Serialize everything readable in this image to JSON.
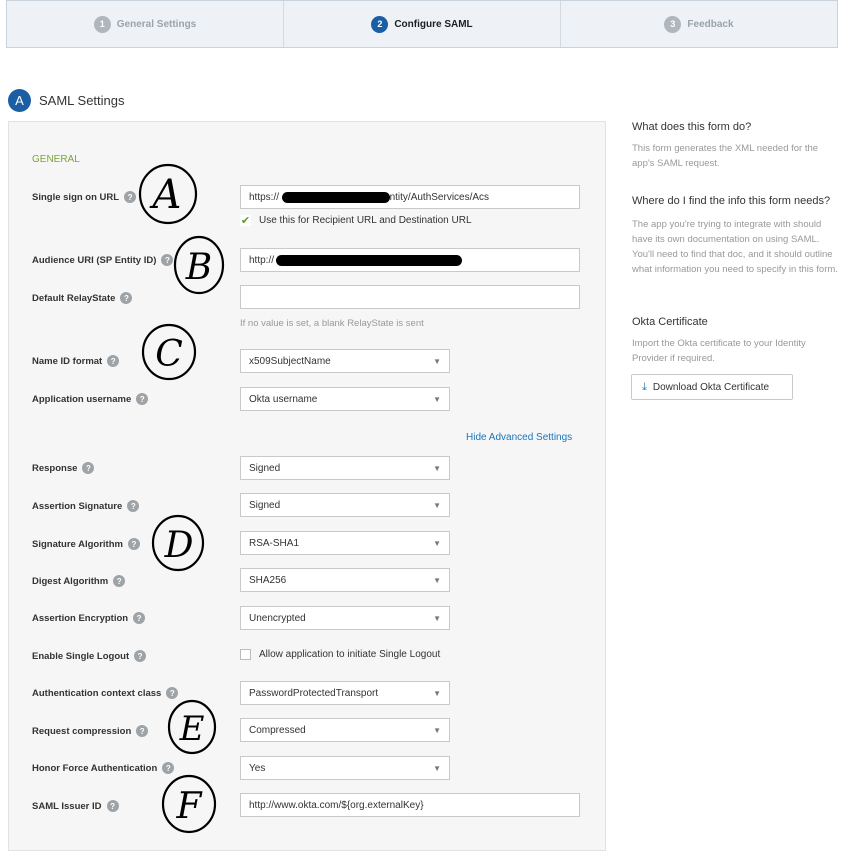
{
  "wizard": {
    "steps": [
      {
        "num": "1",
        "label": "General Settings"
      },
      {
        "num": "2",
        "label": "Configure SAML"
      },
      {
        "num": "3",
        "label": "Feedback"
      }
    ]
  },
  "section": {
    "badge": "A",
    "title": "SAML Settings"
  },
  "form": {
    "general_heading": "GENERAL",
    "sso_url_label": "Single sign on URL",
    "sso_url_prefix": "https://",
    "sso_url_suffix": "entity/AuthServices/Acs",
    "use_recipient_label": "Use this for Recipient URL and Destination URL",
    "audience_label": "Audience URI (SP Entity ID)",
    "audience_prefix": "http://",
    "relay_label": "Default RelayState",
    "relay_value": "",
    "relay_hint": "If no value is set, a blank RelayState is sent",
    "nameid_label": "Name ID format",
    "nameid_value": "x509SubjectName",
    "appuser_label": "Application username",
    "appuser_value": "Okta username",
    "hide_advanced": "Hide Advanced Settings",
    "response_label": "Response",
    "response_value": "Signed",
    "assert_sig_label": "Assertion Signature",
    "assert_sig_value": "Signed",
    "sig_alg_label": "Signature Algorithm",
    "sig_alg_value": "RSA-SHA1",
    "digest_label": "Digest Algorithm",
    "digest_value": "SHA256",
    "assert_enc_label": "Assertion Encryption",
    "assert_enc_value": "Unencrypted",
    "slo_label": "Enable Single Logout",
    "slo_check_label": "Allow application to initiate Single Logout",
    "authctx_label": "Authentication context class",
    "authctx_value": "PasswordProtectedTransport",
    "compress_label": "Request compression",
    "compress_value": "Compressed",
    "force_auth_label": "Honor Force Authentication",
    "force_auth_value": "Yes",
    "issuer_label": "SAML Issuer ID",
    "issuer_value": "http://www.okta.com/${org.externalKey}",
    "help_glyph": "?",
    "caret": "▼"
  },
  "annotations": [
    "A",
    "B",
    "C",
    "D",
    "E",
    "F"
  ],
  "sidebar": {
    "q1_title": "What does this form do?",
    "q1_body": "This form generates the XML needed for the app's SAML request.",
    "q2_title": "Where do I find the info this form needs?",
    "q2_body": "The app you're trying to integrate with should have its own documentation on using SAML. You'll need to find that doc, and it should outline what information you need to specify in this form.",
    "cert_title": "Okta Certificate",
    "cert_body": "Import the Okta certificate to your Identity Provider if required.",
    "download_label": "Download Okta Certificate"
  },
  "colors": {
    "accent": "#1b5ea4",
    "link": "#1b75bb",
    "general": "#7aa53a"
  }
}
